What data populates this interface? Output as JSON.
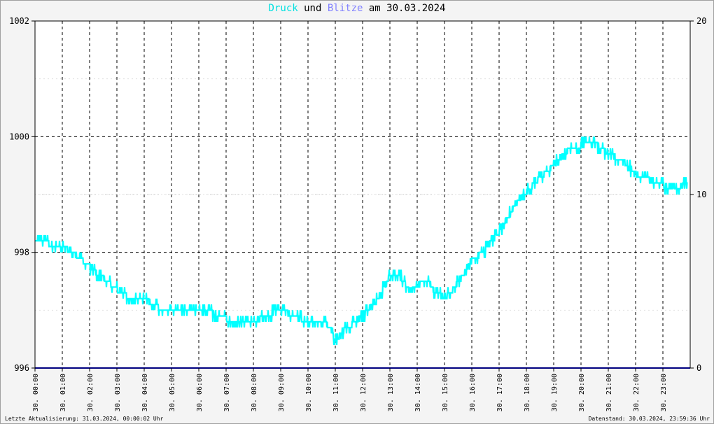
{
  "title": {
    "series1": "Druck",
    "connector1": "und",
    "series2": "Blitze",
    "connector2": "am",
    "date": "30.03.2024",
    "series1_color": "#00e0e0",
    "series2_color": "#8080ff",
    "text_color": "#000000"
  },
  "footer": {
    "left": "Letzte Aktualisierung: 31.03.2024, 00:00:02 Uhr",
    "right": "Datenstand: 30.03.2024, 23:59:36 Uhr"
  },
  "chart_data": {
    "type": "line",
    "title": "Druck und Blitze am 30.03.2024",
    "grid": true,
    "y_left": {
      "ylim": [
        996,
        1002
      ],
      "ticks": [
        "996",
        "998",
        "1000",
        "1002"
      ]
    },
    "y_right": {
      "ylim": [
        0,
        20
      ],
      "ticks": [
        "0",
        "10",
        "20"
      ]
    },
    "x_ticks": [
      "30. 00:00",
      "30. 01:00",
      "30. 02:00",
      "30. 03:00",
      "30. 04:00",
      "30. 05:00",
      "30. 06:00",
      "30. 07:00",
      "30. 08:00",
      "30. 09:00",
      "30. 10:00",
      "30. 11:00",
      "30. 12:00",
      "30. 13:00",
      "30. 14:00",
      "30. 15:00",
      "30. 16:00",
      "30. 17:00",
      "30. 18:00",
      "30. 19:00",
      "30. 20:00",
      "30. 21:00",
      "30. 22:00",
      "30. 23:00"
    ],
    "series": [
      {
        "name": "Druck",
        "axis": "left",
        "color": "#00ffff",
        "x_hours": [
          0,
          0.5,
          1.0,
          1.5,
          2.0,
          2.5,
          3.0,
          3.5,
          4.0,
          4.5,
          5.0,
          5.5,
          6.0,
          6.5,
          7.0,
          7.5,
          8.0,
          8.5,
          9.0,
          9.5,
          10.0,
          10.5,
          10.8,
          11.0,
          11.3,
          11.6,
          12.0,
          12.5,
          13.0,
          13.3,
          13.6,
          14.0,
          14.3,
          14.6,
          15.0,
          15.3,
          15.6,
          16.0,
          16.5,
          17.0,
          17.5,
          18.0,
          18.5,
          19.0,
          19.5,
          20.0,
          20.3,
          20.6,
          21.0,
          21.5,
          22.0,
          22.5,
          23.0,
          23.5,
          23.9
        ],
        "values": [
          998.15,
          998.15,
          998.1,
          997.95,
          997.75,
          997.55,
          997.35,
          997.2,
          997.2,
          997.05,
          996.98,
          997.0,
          997.0,
          996.95,
          996.85,
          996.8,
          996.8,
          996.92,
          997.0,
          996.9,
          996.8,
          996.85,
          996.7,
          996.45,
          996.65,
          996.75,
          996.9,
          997.15,
          997.6,
          997.65,
          997.4,
          997.4,
          997.55,
          997.35,
          997.2,
          997.35,
          997.55,
          997.85,
          998.05,
          998.35,
          998.75,
          999.05,
          999.3,
          999.5,
          999.75,
          999.85,
          999.95,
          999.85,
          999.7,
          999.6,
          999.35,
          999.25,
          999.15,
          999.1,
          999.25
        ]
      },
      {
        "name": "Blitze",
        "axis": "right",
        "color": "#000080",
        "x_hours": [
          0,
          24
        ],
        "values": [
          0,
          0
        ]
      }
    ]
  }
}
